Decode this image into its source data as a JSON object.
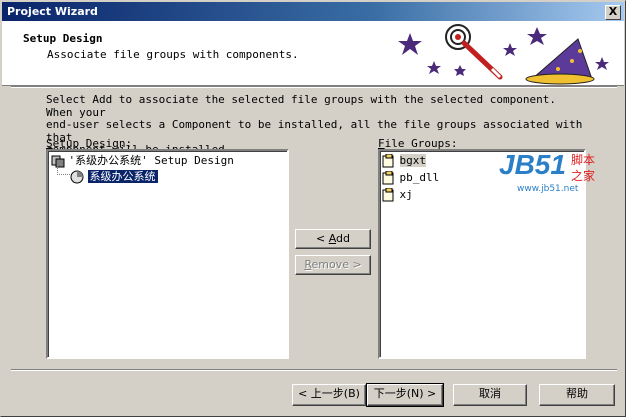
{
  "window": {
    "title": "Project Wizard",
    "close_label": "X"
  },
  "header": {
    "title": "Setup Design",
    "subtitle": "Associate file groups with components."
  },
  "description": [
    "Select Add to associate the selected file groups with the selected component.  When your",
    "end-user selects a Component to be installed, all the file groups associated with that",
    "component will be installed."
  ],
  "setup_design": {
    "label_first": "S",
    "label_rest": "etup Design:",
    "root_label": "'系级办公系统' Setup Design",
    "child_label": "系级办公系统"
  },
  "file_groups": {
    "label_first": "F",
    "label_rest": "ile Groups:",
    "items": [
      "bgxt",
      "pb_dll",
      "xj"
    ]
  },
  "buttons": {
    "add_prefix": "< ",
    "add_key": "A",
    "add_rest": "dd",
    "remove_key": "R",
    "remove_rest": "emove >",
    "back": "< 上一步(B)",
    "next": "下一步(N) >",
    "cancel": "取消",
    "help": "帮助"
  },
  "watermark": {
    "brand": "JB51",
    "cn_top": "脚本",
    "cn_bottom": "之家",
    "url": "www.jb51.net"
  },
  "colors": {
    "title_bar": "#0a246a",
    "selection": "#0a246a",
    "face": "#d4d0c8",
    "watermark_blue": "#2a7fc8",
    "watermark_red": "#e02020"
  },
  "icons": [
    "close-icon",
    "wizard-hat-art",
    "tree-root-icon",
    "component-icon",
    "file-group-icon"
  ]
}
